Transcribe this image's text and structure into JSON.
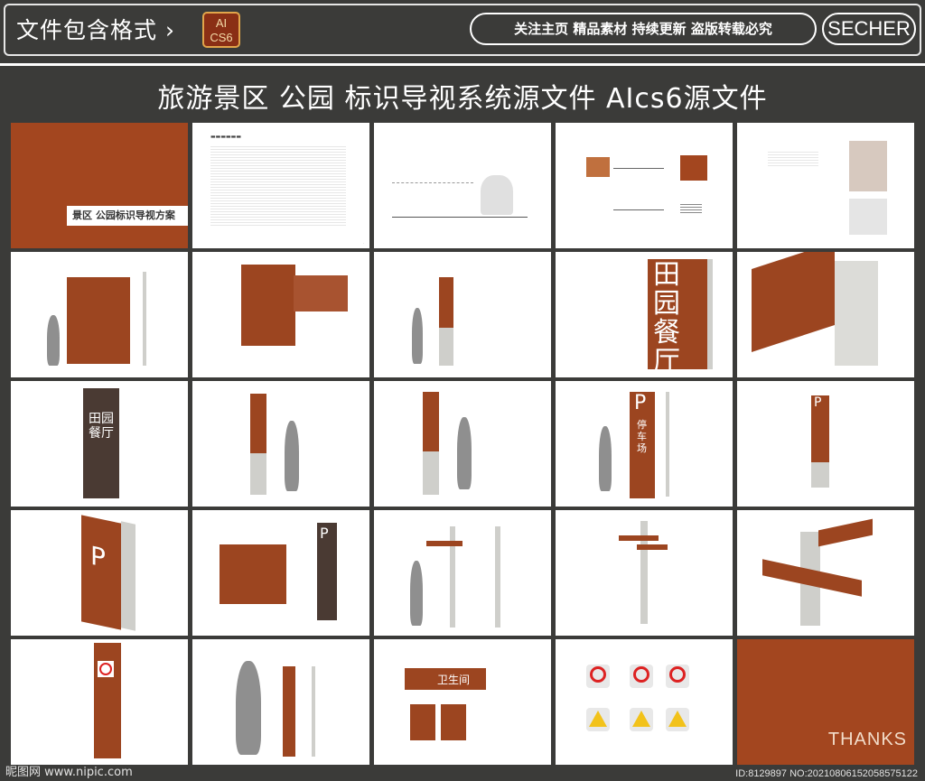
{
  "header": {
    "format_label": "文件包含格式 ›",
    "ai_badge": [
      "AI",
      "CS6"
    ],
    "tags": "关注主页  精品素材  持续更新  盗版转载必究",
    "brand": "SECHER"
  },
  "title": "旅游景区 公园 标识导视系统源文件  AIcs6源文件",
  "tiles": {
    "cover_label": "景区 公园标识导视方案",
    "thanks": "THANKS",
    "sign_char_restaurant": "田园餐厅",
    "sign_char_parking_p": "P",
    "sign_char_parking": "停车场",
    "toilet_label": "卫生间"
  },
  "footer": {
    "site": "昵图网 www.nipic.com",
    "id": "ID:8129897 NO:20210806152058575122"
  }
}
